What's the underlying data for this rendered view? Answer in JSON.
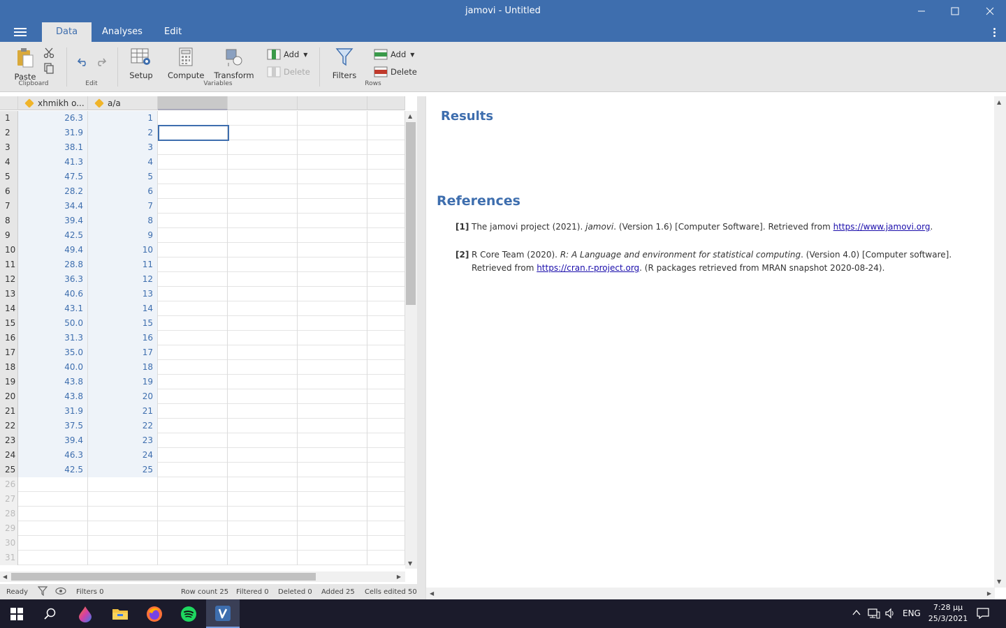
{
  "window": {
    "title": "jamovi - Untitled"
  },
  "tabs": [
    {
      "label": "Data",
      "active": true
    },
    {
      "label": "Analyses",
      "active": false
    },
    {
      "label": "Edit",
      "active": false
    }
  ],
  "ribbon": {
    "paste": "Paste",
    "clipboard_group": "Clipboard",
    "edit_group": "Edit",
    "setup": "Setup",
    "compute": "Compute",
    "transform": "Transform",
    "variables_group": "Variables",
    "var_add": "Add",
    "var_delete": "Delete",
    "filters": "Filters",
    "row_add": "Add",
    "row_delete": "Delete",
    "rows_group": "Rows"
  },
  "columns": [
    {
      "name": "xhmikh o..."
    },
    {
      "name": "a/a"
    }
  ],
  "col1": [
    "26.3",
    "31.9",
    "38.1",
    "41.3",
    "47.5",
    "28.2",
    "34.4",
    "39.4",
    "42.5",
    "49.4",
    "28.8",
    "36.3",
    "40.6",
    "43.1",
    "50.0",
    "31.3",
    "35.0",
    "40.0",
    "43.8",
    "43.8",
    "31.9",
    "37.5",
    "39.4",
    "46.3",
    "42.5"
  ],
  "col2": [
    "1",
    "2",
    "3",
    "4",
    "5",
    "6",
    "7",
    "8",
    "9",
    "10",
    "11",
    "12",
    "13",
    "14",
    "15",
    "16",
    "17",
    "18",
    "19",
    "20",
    "21",
    "22",
    "23",
    "24",
    "25"
  ],
  "row_numbers": [
    "1",
    "2",
    "3",
    "4",
    "5",
    "6",
    "7",
    "8",
    "9",
    "10",
    "11",
    "12",
    "13",
    "14",
    "15",
    "16",
    "17",
    "18",
    "19",
    "20",
    "21",
    "22",
    "23",
    "24",
    "25",
    "26",
    "27",
    "28",
    "29",
    "30",
    "31"
  ],
  "status": {
    "ready": "Ready",
    "filters": "Filters 0",
    "row_count": "Row count 25",
    "filtered": "Filtered 0",
    "deleted": "Deleted 0",
    "added": "Added 25",
    "cells_edited": "Cells edited 50"
  },
  "results": {
    "title": "Results",
    "references_title": "References",
    "ref1": {
      "num": "[1]",
      "before": "The jamovi project (2021). ",
      "italic": "jamovi",
      "after": ". (Version 1.6) [Computer Software]. Retrieved from ",
      "link": "https://www.jamovi.org",
      "end": "."
    },
    "ref2": {
      "num": "[2]",
      "before": "R Core Team (2020). ",
      "italic": "R: A Language and environment for statistical computing",
      "after": ". (Version 4.0) [Computer software]. Retrieved from ",
      "link": "https://cran.r-project.org",
      "end": ". (R packages retrieved from MRAN snapshot 2020-08-24)."
    }
  },
  "taskbar": {
    "lang": "ENG",
    "time": "7:28 μμ",
    "date": "25/3/2021"
  },
  "colors": {
    "accent": "#3e6eae",
    "ribbon": "#e6e6e6",
    "taskbar": "#1b1b2b"
  }
}
